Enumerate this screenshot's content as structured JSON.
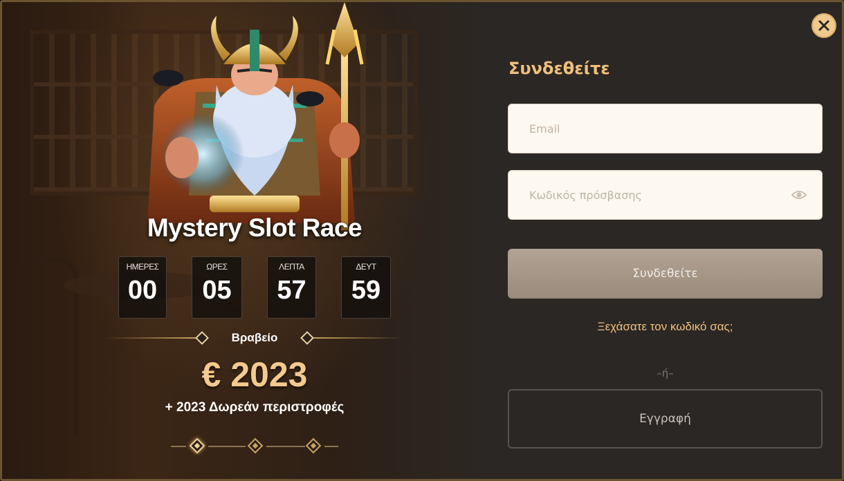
{
  "promo": {
    "title": "Mystery Slot Race",
    "countdown": [
      {
        "label": "ΗΜΕΡΕΣ",
        "value": "00"
      },
      {
        "label": "ΩΡΕΣ",
        "value": "05"
      },
      {
        "label": "ΛΕΠΤΑ",
        "value": "57"
      },
      {
        "label": "ΔΕΥΤ",
        "value": "59"
      }
    ],
    "prize_label": "Βραβείο",
    "prize_amount": "€ 2023",
    "prize_spins": "+ 2023 Δωρεάν περιστροφές",
    "slides_total": 3,
    "slide_active": 1
  },
  "login": {
    "title": "Συνδεθείτε",
    "email_placeholder": "Email",
    "email_value": "",
    "password_placeholder": "Κωδικός πρόσβασης",
    "password_value": "",
    "submit_label": "Συνδεθείτε",
    "forgot_label": "Ξεχάσατε τον κωδικό σας;",
    "or_label": "–ή–",
    "register_label": "Εγγραφή"
  },
  "icons": {
    "close": "close-icon",
    "eye": "eye-icon"
  },
  "colors": {
    "accent_gold": "#f0c07c",
    "prize_gold": "#f4c98e",
    "panel_bg": "#2b2724",
    "input_bg": "#fdf8f0",
    "submit_bg": "#a89889",
    "border": "#6b5430"
  }
}
